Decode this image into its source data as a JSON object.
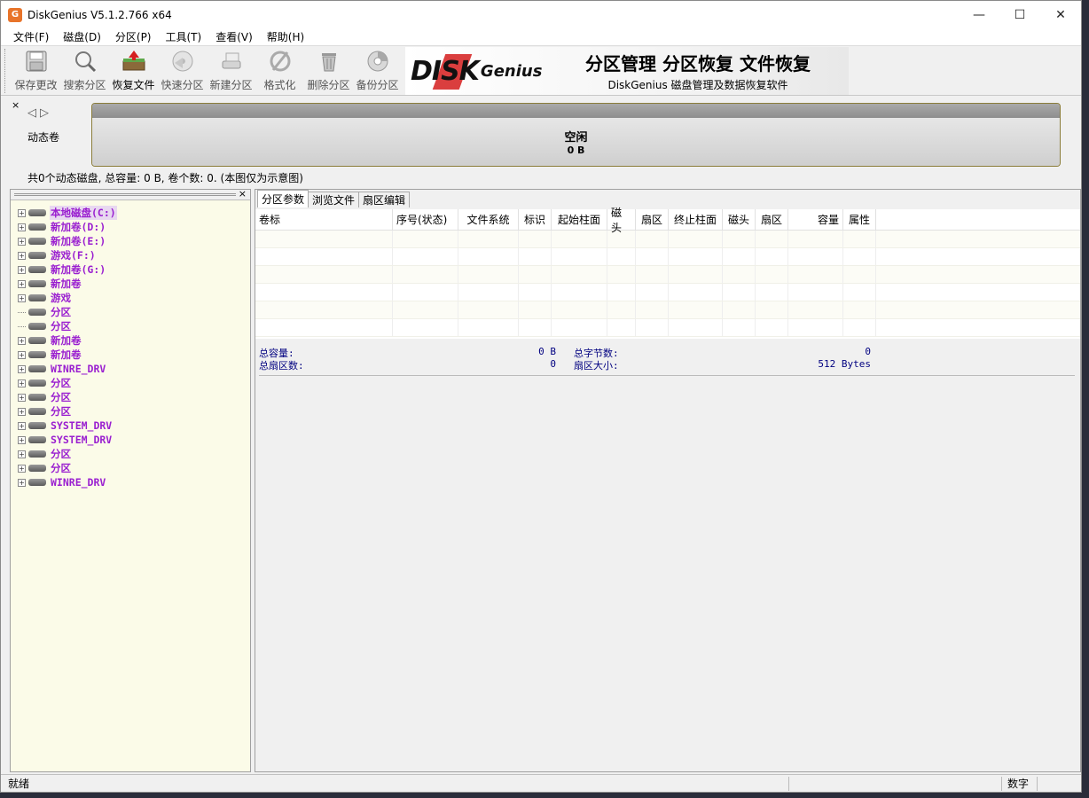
{
  "app": {
    "title": "DiskGenius V5.1.2.766 x64",
    "icon_letter": "G",
    "minimize": "—",
    "maximize": "☐",
    "close": "✕"
  },
  "menu": [
    "文件(F)",
    "磁盘(D)",
    "分区(P)",
    "工具(T)",
    "查看(V)",
    "帮助(H)"
  ],
  "toolbar": {
    "buttons": [
      {
        "label": "保存更改",
        "icon": "save-icon"
      },
      {
        "label": "搜索分区",
        "icon": "search-partition-icon"
      },
      {
        "label": "恢复文件",
        "icon": "recover-files-icon"
      },
      {
        "label": "快速分区",
        "icon": "quick-partition-icon"
      },
      {
        "label": "新建分区",
        "icon": "new-partition-icon"
      },
      {
        "label": "格式化",
        "icon": "format-icon"
      },
      {
        "label": "删除分区",
        "icon": "delete-partition-icon"
      },
      {
        "label": "备份分区",
        "icon": "backup-partition-icon"
      }
    ],
    "banner": {
      "logo": "DISK",
      "logo_genius": "Genius",
      "slogan": "分区管理 分区恢复 文件恢复",
      "sub": "DiskGenius 磁盘管理及数据恢复软件"
    }
  },
  "diskmap": {
    "close": "×",
    "prev": "◁",
    "next": "▷",
    "label": "动态卷",
    "free_label": "空闲",
    "free_size": "0 B",
    "info": "共0个动态磁盘, 总容量: 0 B, 卷个数: 0. (本图仅为示意图)"
  },
  "tree": {
    "close": "×",
    "items": [
      {
        "label": "本地磁盘(C:)",
        "expandable": true,
        "selected": true
      },
      {
        "label": "新加卷(D:)",
        "expandable": true
      },
      {
        "label": "新加卷(E:)",
        "expandable": true
      },
      {
        "label": "游戏(F:)",
        "expandable": true
      },
      {
        "label": "新加卷(G:)",
        "expandable": true
      },
      {
        "label": "新加卷",
        "expandable": true
      },
      {
        "label": "游戏",
        "expandable": true
      },
      {
        "label": "分区",
        "expandable": false
      },
      {
        "label": "分区",
        "expandable": false
      },
      {
        "label": "新加卷",
        "expandable": true
      },
      {
        "label": "新加卷",
        "expandable": true
      },
      {
        "label": "WINRE_DRV",
        "expandable": true
      },
      {
        "label": "分区",
        "expandable": true
      },
      {
        "label": "分区",
        "expandable": true
      },
      {
        "label": "分区",
        "expandable": true
      },
      {
        "label": "SYSTEM_DRV",
        "expandable": true
      },
      {
        "label": "SYSTEM_DRV",
        "expandable": true
      },
      {
        "label": "分区",
        "expandable": true
      },
      {
        "label": "分区",
        "expandable": true
      },
      {
        "label": "WINRE_DRV",
        "expandable": true
      }
    ]
  },
  "tabs": [
    "分区参数",
    "浏览文件",
    "扇区编辑"
  ],
  "grid": {
    "columns": [
      "卷标",
      "序号(状态)",
      "文件系统",
      "标识",
      "起始柱面",
      "磁头",
      "扇区",
      "终止柱面",
      "磁头",
      "扇区",
      "容量",
      "属性"
    ]
  },
  "summary": {
    "total_capacity_label": "总容量:",
    "total_capacity_value": "0 B",
    "total_sectors_label": "总扇区数:",
    "total_sectors_value": "0",
    "total_bytes_label": "总字节数:",
    "total_bytes_value": "0",
    "sector_size_label": "扇区大小:",
    "sector_size_value": "512 Bytes"
  },
  "status": {
    "text": "就绪",
    "numlock": "数字"
  }
}
